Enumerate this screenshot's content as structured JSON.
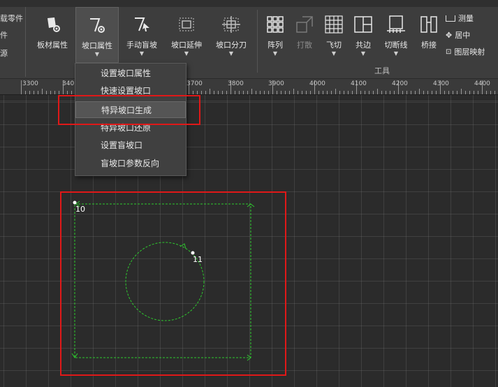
{
  "left_fragment": [
    "载零件",
    "件",
    "源"
  ],
  "tools": [
    {
      "name": "plate-property",
      "label": "板材属性"
    },
    {
      "name": "bevel-property",
      "label": "坡口属性"
    },
    {
      "name": "manual-blind-bevel",
      "label": "手动盲坡"
    },
    {
      "name": "bevel-extend",
      "label": "坡口延伸"
    },
    {
      "name": "bevel-split",
      "label": "坡口分刀"
    },
    {
      "name": "array",
      "label": "阵列"
    },
    {
      "name": "scatter",
      "label": "打散"
    },
    {
      "name": "fly-cut",
      "label": "飞切"
    },
    {
      "name": "common-edge",
      "label": "共边"
    },
    {
      "name": "cut-break-line",
      "label": "切断线"
    },
    {
      "name": "bridge",
      "label": "桥接"
    }
  ],
  "right_tools": [
    "测量",
    "居中",
    "图层映射"
  ],
  "group_label": "工具",
  "dropdown": {
    "items": [
      "设置坡口属性",
      "快速设置坡口",
      "特异坡口生成",
      "特异坡口还原",
      "设置盲坡口",
      "盲坡口参数反向"
    ],
    "highlighted": 2
  },
  "ruler_labels": [
    "3300",
    "340",
    "3700",
    "3800",
    "3900",
    "4000",
    "4100",
    "4200",
    "4300",
    "4400"
  ],
  "parts": {
    "rect_label": "10",
    "circle_label": "11"
  },
  "colors": {
    "accent_red": "#e01818",
    "path_green": "#2ec82e"
  }
}
